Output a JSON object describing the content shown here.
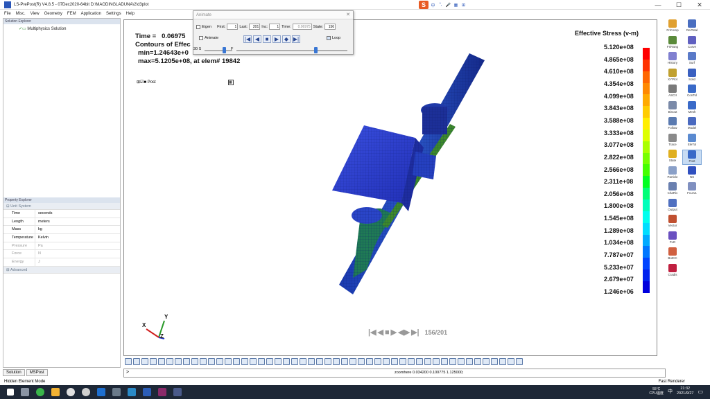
{
  "titlebar": {
    "title": "LS-PrePost(R) V4.8.5 - 07Dec2020-64bit D:\\MAODINGLADUNA\\2\\d3plot",
    "min": "—",
    "max": "☐",
    "close": "✕"
  },
  "menu": [
    "File",
    "Misc.",
    "View",
    "Geometry",
    "FEM",
    "Application",
    "Settings",
    "Help"
  ],
  "ime": {
    "logo": "S",
    "items": [
      "中",
      "°,",
      "🎤",
      "▦",
      "⊞"
    ]
  },
  "solution_explorer": {
    "header": "Solution Explorer",
    "item": "Multiphysics Solution"
  },
  "property_explorer": {
    "header": "Property Explorer",
    "group_unit": "Unit System",
    "rows": [
      {
        "k": "Time",
        "v": "seconds"
      },
      {
        "k": "Length",
        "v": "meters"
      },
      {
        "k": "Mass",
        "v": "kg"
      },
      {
        "k": "Temperature",
        "v": "Kelvin"
      },
      {
        "k": "Pressure",
        "v": "Pa"
      },
      {
        "k": "Force",
        "v": "N"
      },
      {
        "k": "Energy",
        "v": "J"
      }
    ],
    "group_adv": "Advanced"
  },
  "bottom_tabs": [
    "Solution",
    "MSPost"
  ],
  "viewport": {
    "time_label": "Time =",
    "time_value": "0.06975",
    "contours": "Contours of Effec",
    "min": "min=1.24643e+0",
    "max": "max=5.1205e+08, at elem# 19842",
    "post_label": "Post",
    "frame_counter": "156/201",
    "axis_x": "X",
    "axis_y": "Y",
    "axis_z": "Z"
  },
  "legend": {
    "title": "Effective Stress (v-m)",
    "labels": [
      "5.120e+08",
      "4.865e+08",
      "4.610e+08",
      "4.354e+08",
      "4.099e+08",
      "3.843e+08",
      "3.588e+08",
      "3.333e+08",
      "3.077e+08",
      "2.822e+08",
      "2.566e+08",
      "2.311e+08",
      "2.056e+08",
      "1.800e+08",
      "1.545e+08",
      "1.289e+08",
      "1.034e+08",
      "7.787e+07",
      "5.233e+07",
      "2.679e+07",
      "1.246e+06"
    ],
    "colors": [
      "#ff0000",
      "#ff3300",
      "#ff6600",
      "#ff8800",
      "#ffaa00",
      "#ffcc00",
      "#ffee00",
      "#ddff00",
      "#aaff00",
      "#77ff00",
      "#44ff00",
      "#00ff22",
      "#00ff77",
      "#00ffbb",
      "#00ffee",
      "#00ddff",
      "#00aaff",
      "#0077ff",
      "#0044ff",
      "#0022ee",
      "#0000dd"
    ]
  },
  "animate_dialog": {
    "title": "Animate",
    "eigen": "Eigen",
    "first_label": "First:",
    "first": "1",
    "last_label": "Last:",
    "last": "201",
    "inc_label": "Inc:",
    "inc": "1",
    "time_label": "Time:",
    "time": "0.06975",
    "state_label": "State:",
    "state": "156",
    "animate": "Animate",
    "loop": "Loop",
    "speed": "30 S",
    "f": "F"
  },
  "right_toolbar": [
    {
      "l": "FriComp",
      "c": "#e0a030"
    },
    {
      "l": "ReiTotal",
      "c": "#4a6ec0"
    },
    {
      "l": "FriRang",
      "c": "#5a8a3a"
    },
    {
      "l": "Curve",
      "c": "#6060c0"
    },
    {
      "l": "History",
      "c": "#8080d0"
    },
    {
      "l": "Surf",
      "c": "#5a7ac8"
    },
    {
      "l": "XYPlot",
      "c": "#c0a030"
    },
    {
      "l": "Solid",
      "c": "#3a60c0"
    },
    {
      "l": "ASCII",
      "c": "#7a7a7a"
    },
    {
      "l": "ConTol",
      "c": "#3a6ac8"
    },
    {
      "l": "Binout",
      "c": "#7a8aa8"
    },
    {
      "l": "Mesh",
      "c": "#3a6ac8"
    },
    {
      "l": "Follow",
      "c": "#5a7ab0"
    },
    {
      "l": "Model",
      "c": "#4a6ac0"
    },
    {
      "l": "Trace",
      "c": "#8a8a8a"
    },
    {
      "l": "EleTol",
      "c": "#5a8ad0"
    },
    {
      "l": "State",
      "c": "#e0b020"
    },
    {
      "l": "Post",
      "c": "#3a6ac8",
      "sel": true
    },
    {
      "l": "Particle",
      "c": "#8aa0c8"
    },
    {
      "l": "NS",
      "c": "#3050c0"
    },
    {
      "l": "ChaRic",
      "c": "#6a80b0"
    },
    {
      "l": "Fcurv1",
      "c": "#8090c0"
    },
    {
      "l": "Output",
      "c": "#5070c0"
    },
    {
      "l": "",
      "c": ""
    },
    {
      "l": "Vector",
      "c": "#c05030"
    },
    {
      "l": "",
      "c": ""
    },
    {
      "l": "FLD",
      "c": "#6a50c0"
    },
    {
      "l": "",
      "c": ""
    },
    {
      "l": "BotCC",
      "c": "#d06040"
    },
    {
      "l": "",
      "c": ""
    },
    {
      "l": "Cradis",
      "c": "#c02040"
    }
  ],
  "cmdline": {
    "prompt": ">",
    "zoom": "zoomhere 0.034200 0.100775 1.125000;"
  },
  "status": {
    "left": "Hidden Element Mode",
    "right": "Fast Renderer"
  },
  "taskbar": {
    "temp": "55°C",
    "cpu": "CPU温度",
    "time": "21:32",
    "date": "2021/9/27",
    "lang": "中"
  },
  "colors": {
    "mesh_blue": "#2b3fd0",
    "mesh_dark": "#1a2a8c",
    "mesh_green": "#2f7a3a"
  }
}
